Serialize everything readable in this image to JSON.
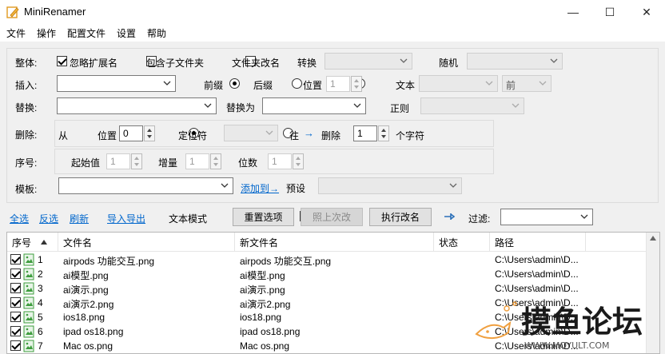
{
  "window": {
    "title": "MiniRenamer",
    "minimize": "—",
    "maximize": "☐",
    "close": "✕"
  },
  "menu": [
    "文件",
    "操作",
    "配置文件",
    "设置",
    "帮助"
  ],
  "whole": {
    "label": "整体:",
    "ignore_ext": "忽略扩展名",
    "include_sub": "包含子文件夹",
    "folder_rename": "文件夹改名",
    "convert_label": "转换",
    "convert_value": "",
    "random_label": "随机",
    "random_value": ""
  },
  "insert": {
    "label": "插入:",
    "value": "",
    "prefix": "前缀",
    "suffix": "后缀",
    "position": "位置",
    "position_value": "1",
    "text": "文本",
    "text_value": "",
    "front": "前"
  },
  "replace": {
    "label": "替换:",
    "value": "",
    "replace_with_label": "替换为",
    "replace_with_value": "",
    "regex": "正则",
    "regex_value": ""
  },
  "delete": {
    "label": "删除:",
    "from": "从",
    "position": "位置",
    "position_value": "0",
    "locator": "定位符",
    "locator_value": "",
    "to": "往",
    "arrow": "→",
    "delete_label": "删除",
    "count_value": "1",
    "chars_label": "个字符"
  },
  "serial": {
    "label": "序号:",
    "start": "起始值",
    "start_value": "1",
    "step": "增量",
    "step_value": "1",
    "digits": "位数",
    "digits_value": "1"
  },
  "template": {
    "label": "模板:",
    "value": "",
    "add_to": "添加到→",
    "preset": "预设",
    "preset_value": ""
  },
  "toolbar": {
    "select_all": "全选",
    "invert": "反选",
    "refresh": "刷新",
    "import_export": "导入导出",
    "text_mode": "文本模式",
    "reset": "重置选项",
    "last_time": "照上次改",
    "execute": "执行改名",
    "filter_label": "过滤:",
    "filter_value": ""
  },
  "table": {
    "headers": {
      "index": "序号",
      "filename": "文件名",
      "newname": "新文件名",
      "status": "状态",
      "path": "路径"
    },
    "rows": [
      {
        "index": "1",
        "filename": "airpods 功能交互.png",
        "newname": "airpods 功能交互.png",
        "status": "",
        "path": "C:\\Users\\admin\\D..."
      },
      {
        "index": "2",
        "filename": "ai模型.png",
        "newname": "ai模型.png",
        "status": "",
        "path": "C:\\Users\\admin\\D..."
      },
      {
        "index": "3",
        "filename": "ai演示.png",
        "newname": "ai演示.png",
        "status": "",
        "path": "C:\\Users\\admin\\D..."
      },
      {
        "index": "4",
        "filename": "ai演示2.png",
        "newname": "ai演示2.png",
        "status": "",
        "path": "C:\\Users\\admin\\D..."
      },
      {
        "index": "5",
        "filename": "ios18.png",
        "newname": "ios18.png",
        "status": "",
        "path": "C:\\Users\\admin\\D..."
      },
      {
        "index": "6",
        "filename": "ipad os18.png",
        "newname": "ipad os18.png",
        "status": "",
        "path": "C:\\Users\\admin\\D..."
      },
      {
        "index": "7",
        "filename": "Mac os.png",
        "newname": "Mac os.png",
        "status": "",
        "path": "C:\\Users\\admin\\D..."
      }
    ]
  },
  "watermark": {
    "text": "摸鱼论坛",
    "url": "WWW.MOYULT.COM"
  },
  "colors": {
    "link": "#0066cc",
    "watermark": "#f0a040",
    "icon_green": "#3c9c3c"
  }
}
